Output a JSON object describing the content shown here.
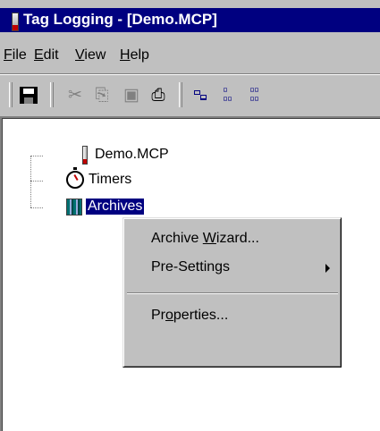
{
  "window": {
    "title": "Tag Logging - [Demo.MCP]"
  },
  "menubar": [
    {
      "ul": "F",
      "rest": "ile"
    },
    {
      "ul": "E",
      "rest": "dit"
    },
    {
      "ul": "V",
      "rest": "iew"
    },
    {
      "ul": "H",
      "rest": "elp"
    }
  ],
  "toolbar": {
    "icons": [
      "save-icon",
      "cut-icon",
      "copy-icon",
      "paste-icon",
      "print-icon",
      "view-list-icon",
      "view-tree-icon",
      "view-details-icon"
    ]
  },
  "tree": {
    "root": "Demo.MCP",
    "children": [
      "Timers",
      "Archives"
    ],
    "selected": "Archives"
  },
  "context_menu": {
    "items": [
      {
        "pre": "Archive ",
        "ul": "W",
        "post": "izard..."
      },
      {
        "pre": "Pre-Settings",
        "ul": "",
        "post": ""
      },
      {
        "pre": "Pr",
        "ul": "o",
        "post": "perties..."
      }
    ]
  },
  "colors": {
    "titlebar": "#000080",
    "selection": "#000080",
    "face": "#c0c0c0"
  }
}
